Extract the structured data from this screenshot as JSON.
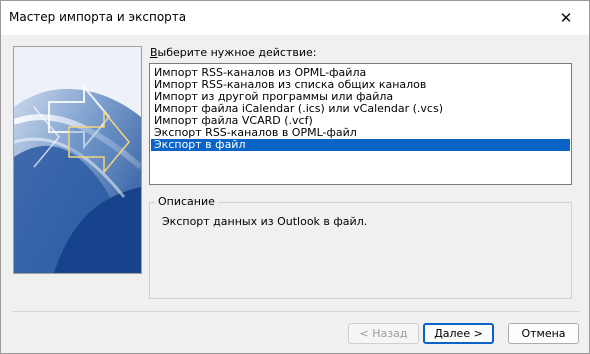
{
  "window": {
    "title": "Мастер импорта и экспорта",
    "close_glyph": "✕"
  },
  "prompt": {
    "accel": "В",
    "rest": "ыберите нужное действие:"
  },
  "actions": [
    "Импорт RSS-каналов из OPML-файла",
    "Импорт RSS-каналов из списка общих каналов",
    "Импорт из другой программы или файла",
    "Импорт файла iCalendar (.ics) или vCalendar (.vcs)",
    "Импорт файла VCARD (.vcf)",
    "Экспорт RSS-каналов в OPML-файл",
    "Экспорт в файл"
  ],
  "selected_action_index": 6,
  "description": {
    "legend": "Описание",
    "text": "Экспорт данных из Outlook в файл."
  },
  "buttons": {
    "back": "< Назад",
    "next": "Далее >",
    "cancel": "Отмена"
  },
  "colors": {
    "selection": "#0a64c8",
    "graphic_blue": "#2d5ba0",
    "graphic_light": "#e8eef6"
  },
  "icons": {
    "close": "close-icon",
    "side_graphic": "arrows-graphic"
  }
}
